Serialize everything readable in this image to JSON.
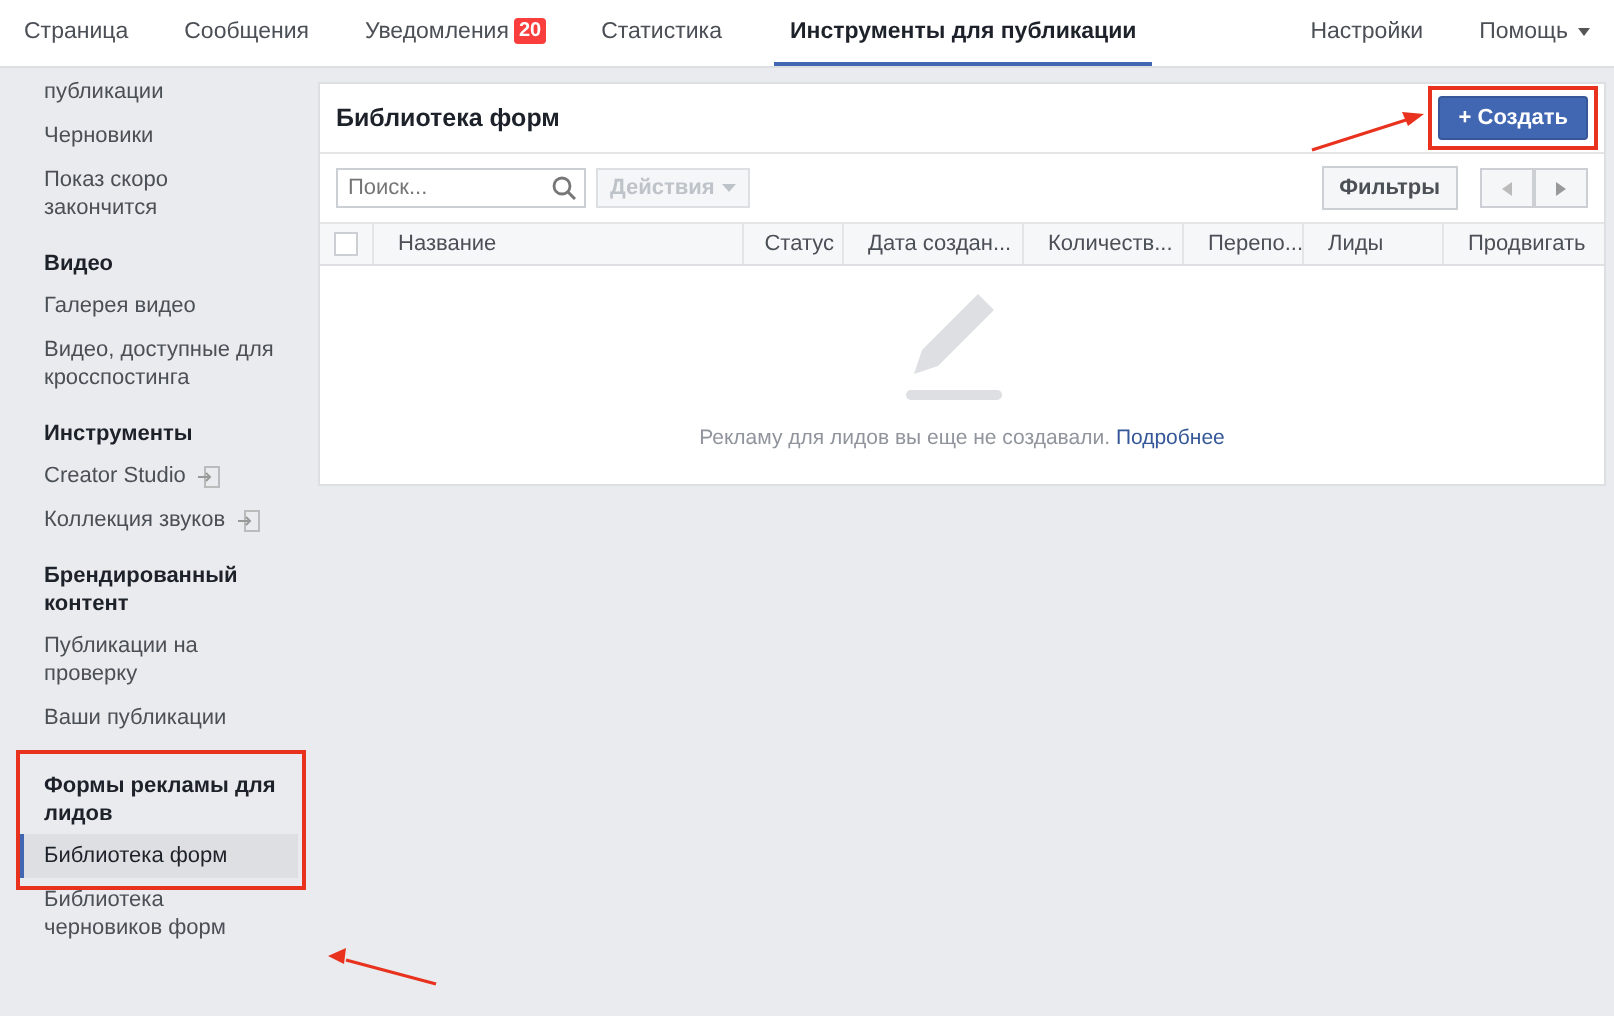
{
  "top_nav": {
    "tabs": [
      {
        "label": "Страница",
        "selected": false
      },
      {
        "label": "Сообщения",
        "selected": false
      },
      {
        "label": "Уведомления",
        "badge": "20",
        "selected": false
      },
      {
        "label": "Статистика",
        "selected": false
      },
      {
        "label": "Инструменты для публикации",
        "selected": true
      }
    ],
    "right_items": [
      {
        "label": "Настройки",
        "kind": "link"
      },
      {
        "label": "Помощь",
        "kind": "dropdown"
      }
    ]
  },
  "sidebar": {
    "sections": [
      {
        "items": [
          {
            "label": "публикации",
            "kind": "link",
            "selected": false
          },
          {
            "label": "Черновики",
            "kind": "link",
            "selected": false
          },
          {
            "label": "Показ скоро закончится",
            "kind": "link",
            "selected": false
          }
        ]
      },
      {
        "heading": "Видео",
        "items": [
          {
            "label": "Галерея видео",
            "kind": "link",
            "selected": false
          },
          {
            "label": "Видео, доступные для кросспостинга",
            "kind": "link",
            "selected": false
          }
        ]
      },
      {
        "heading": "Инструменты",
        "items": [
          {
            "label": "Creator Studio",
            "kind": "external",
            "selected": false
          },
          {
            "label": "Коллекция звуков",
            "kind": "external",
            "selected": false
          }
        ]
      },
      {
        "heading": "Брендированный контент",
        "items": [
          {
            "label": "Публикации на проверку",
            "kind": "link",
            "selected": false
          },
          {
            "label": "Ваши публикации",
            "kind": "link",
            "selected": false
          }
        ]
      },
      {
        "heading": "Формы рекламы для лидов",
        "highlighted": true,
        "items": [
          {
            "label": "Библиотека форм",
            "kind": "link",
            "selected": true
          },
          {
            "label": "Библиотека черновиков форм",
            "kind": "link",
            "selected": false
          }
        ]
      }
    ]
  },
  "panel": {
    "title": "Библиотека форм",
    "create_button": {
      "label": "+ Создать",
      "highlighted": true
    },
    "search": {
      "placeholder": "Поиск..."
    },
    "actions_button": {
      "label": "Действия",
      "disabled": true
    },
    "filters_button": "Фильтры",
    "table": {
      "select_all_checked": false,
      "columns": [
        "Название",
        "Статус",
        "Дата создан...",
        "Количеств...",
        "Перепо...",
        "Лиды",
        "Продвигать"
      ]
    },
    "empty_state": {
      "text": "Рекламу для лидов вы еще не создавали.",
      "link": "Подробнее"
    }
  }
}
